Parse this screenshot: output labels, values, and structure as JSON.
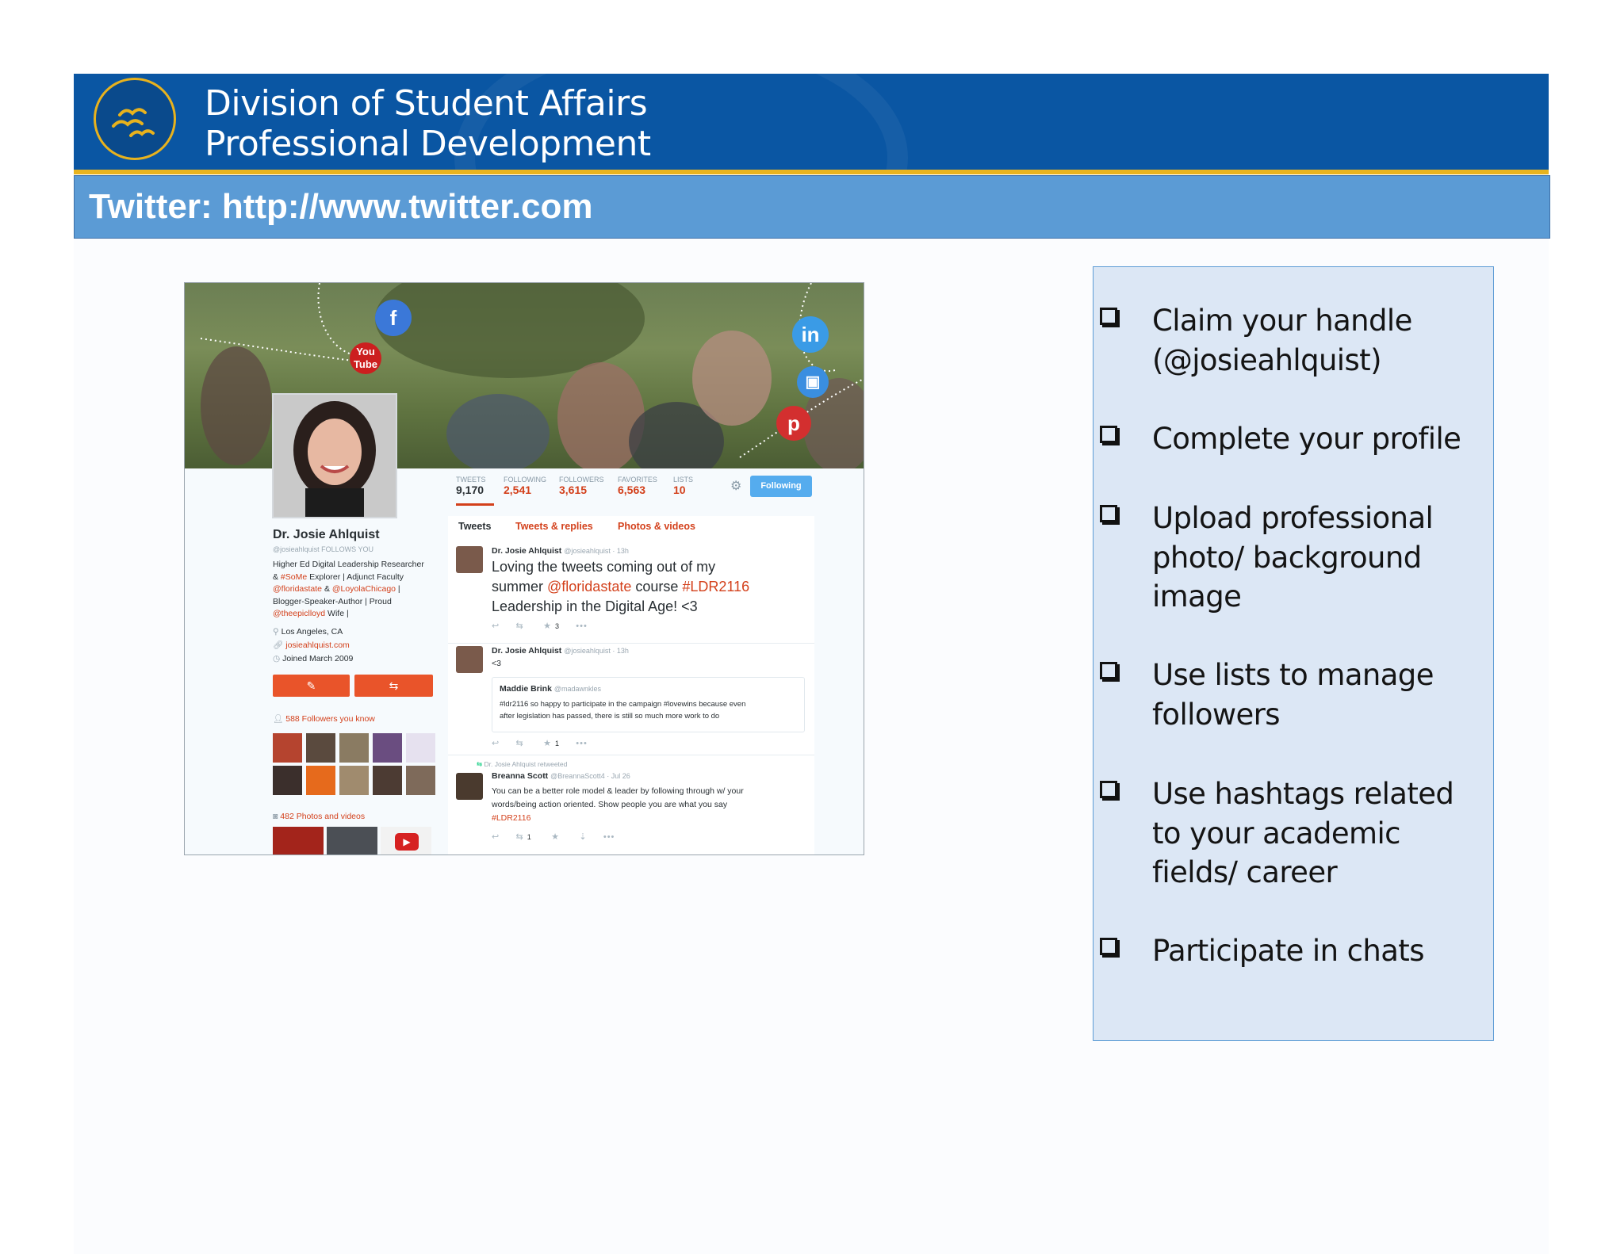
{
  "header": {
    "title_line1": "Division of Student Affairs",
    "title_line2": "Professional Development",
    "logo_icon": "birds-logo-icon"
  },
  "subtitle": "Twitter: http://www.twitter.com",
  "profile": {
    "stats": [
      {
        "label": "TWEETS",
        "value": "9,170"
      },
      {
        "label": "FOLLOWING",
        "value": "2,541"
      },
      {
        "label": "FOLLOWERS",
        "value": "3,615"
      },
      {
        "label": "FAVORITES",
        "value": "6,563"
      },
      {
        "label": "LISTS",
        "value": "10"
      }
    ],
    "follow_button": "Following",
    "name": "Dr. Josie Ahlquist",
    "handle": "@josieahlquist  FOLLOWS YOU",
    "bio_1": "Higher Ed Digital Leadership Researcher",
    "bio_2a": "& ",
    "bio_2b": "#SoMe",
    "bio_2c": " Explorer | Adjunct Faculty",
    "bio_3a": "@floridastate",
    "bio_3b": " & ",
    "bio_3c": "@LoyolaChicago",
    "bio_3d": " |",
    "bio_4": "Blogger-Speaker-Author | Proud",
    "bio_5a": "@theepicllоyd",
    "bio_5b": " Wife |",
    "location": "Los Angeles, CA",
    "website": "josieahlquist.com",
    "joined": "Joined March 2009",
    "followers_you_know": "588 Followers you know",
    "photos_videos": "482 Photos and videos"
  },
  "tabs": [
    "Tweets",
    "Tweets & replies",
    "Photos & videos"
  ],
  "tweets": [
    {
      "name": "Dr. Josie Ahlquist",
      "meta": "@josieahlquist · 13h",
      "line1": "Loving the tweets coming out of my",
      "line2a": "summer ",
      "line2b": "@floridastate",
      "line2c": " course ",
      "line2d": "#LDR2116",
      "line3": "Leadership in the Digital Age! <3",
      "fav_count": "3"
    },
    {
      "name": "Dr. Josie Ahlquist",
      "meta": "@josieahlquist · 13h",
      "text": "<3",
      "quote_name": "Maddie Brink",
      "quote_handle": "@madawnkles",
      "quote_line1": "#ldr2116 so happy to participate in the campaign #lovewins because even",
      "quote_line2": "after legislation has passed, there is still so much more work to do",
      "fav_count": "1"
    },
    {
      "retweeted_by": "Dr. Josie Ahlquist retweeted",
      "name": "Breanna Scott",
      "meta": "@BreannaScott4 · Jul 26",
      "line1": "You can be a better role model & leader by following through w/ your",
      "line2": "words/being action oriented. Show people you are what you say",
      "hashtag": "#LDR2116",
      "rt_count": "1"
    }
  ],
  "checklist": [
    "Claim your handle (@josieahlquist)",
    "Complete your profile",
    "Upload professional photo/ background image",
    "Use lists to manage followers",
    "Use hashtags related to your academic fields/ career",
    "Participate in chats"
  ],
  "colors": {
    "banner": "#0a56a3",
    "gold": "#e7b31f",
    "subbar": "#5b9bd5",
    "panel": "#dce7f5",
    "twitter_accent": "#d3401b"
  }
}
